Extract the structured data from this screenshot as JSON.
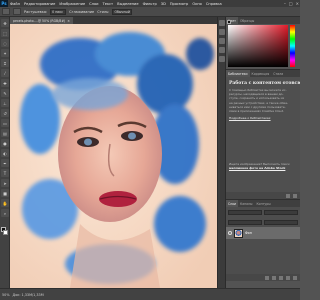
{
  "app": {
    "logo": "Ps"
  },
  "menubar": {
    "items": [
      "Файл",
      "Редактирование",
      "Изображение",
      "Слои",
      "Текст",
      "Выделение",
      "Фильтр",
      "3D",
      "Просмотр",
      "Окно",
      "Справка"
    ],
    "minimize": "–",
    "maximize": "□",
    "close": "×"
  },
  "options": {
    "feather_label": "Растушевка:",
    "feather_value": "0 пикс",
    "smooth_label": "Сглаживание",
    "style_label": "Стиль:",
    "style_value": "Обычный"
  },
  "document": {
    "tab_label": "pexels-photo-...@ 50% (RGB/8#)",
    "close": "×"
  },
  "statusbar": {
    "zoom": "50%",
    "doc_info": "Док: 1,33M/1,33M"
  },
  "right_panels": {
    "color_tabs": [
      "Цвет",
      "Образцы"
    ],
    "library_tabs": [
      "Библиотеки",
      "Коррекция",
      "Стили"
    ],
    "library_heading": "Работа с контентом отовсюду",
    "library_text": [
      "С помощью библиотек вы можете ис-",
      "ресурсы, находящиеся в вашем до-",
      "ступе, сохранять и использовать их",
      "на разных устройствах, а также обме-",
      "ниваться ими с другими пользовате-",
      "лями в приложениях Creative Cloud."
    ],
    "library_link": "Подробнее о библиотеках",
    "stock_text": "Ищете изображение? Выполнить поиск",
    "stock_link": "миллионов фото на Adobe Stock",
    "layers_tabs": [
      "Слои",
      "Каналы",
      "Контуры"
    ],
    "layer_name": "Фон"
  },
  "colors": {
    "accent": "#31a8ff",
    "panel": "#535353",
    "dark": "#3c3c3c"
  }
}
